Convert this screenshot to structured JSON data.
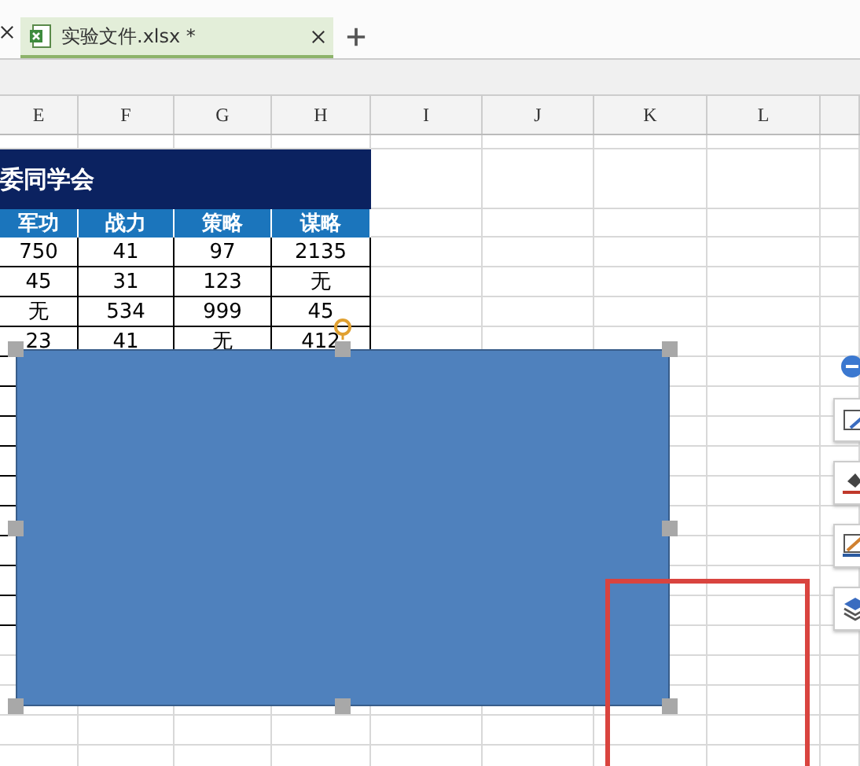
{
  "tabs": [
    {
      "label": "实验文件.xlsx *",
      "selected": true
    }
  ],
  "columns": [
    "E",
    "F",
    "G",
    "H",
    "I",
    "J",
    "K",
    "L"
  ],
  "sheet": {
    "title": "委同学会",
    "headers": [
      "军功",
      "战力",
      "策略",
      "谋略"
    ],
    "rows": [
      [
        "750",
        "41",
        "97",
        "2135"
      ],
      [
        "45",
        "31",
        "123",
        "无"
      ],
      [
        "无",
        "534",
        "999",
        "45"
      ],
      [
        "23",
        "41",
        "无",
        "412"
      ]
    ]
  },
  "shape": {
    "selected": true
  }
}
